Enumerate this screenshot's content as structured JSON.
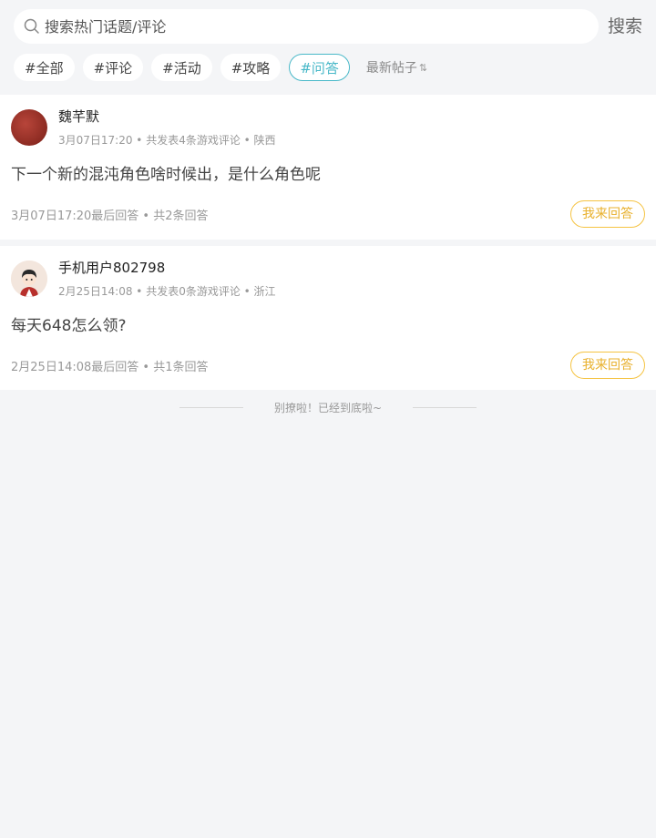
{
  "search": {
    "placeholder": "搜索热门话题/评论",
    "value": "",
    "button_label": "搜索"
  },
  "filters": {
    "tags": [
      {
        "label": "#全部",
        "active": false
      },
      {
        "label": "#评论",
        "active": false
      },
      {
        "label": "#活动",
        "active": false
      },
      {
        "label": "#攻略",
        "active": false
      },
      {
        "label": "#问答",
        "active": true
      }
    ],
    "sort_label": "最新帖子",
    "sort_icon": "⇅"
  },
  "posts": [
    {
      "username": "魏芊默",
      "meta": "3月07日17:20 • 共发表4条游戏评论 • 陕西",
      "title": "下一个新的混沌角色啥时候出，是什么角色呢",
      "footer": "3月07日17:20最后回答 • 共2条回答",
      "answer_label": "我来回答"
    },
    {
      "username": "手机用户802798",
      "meta": "2月25日14:08 • 共发表0条游戏评论 • 浙江",
      "title": "每天648怎么领?",
      "footer": "2月25日14:08最后回答 • 共1条回答",
      "answer_label": "我来回答"
    }
  ],
  "end_text": "别撩啦！已经到底啦~",
  "colors": {
    "accent_teal": "#48b8c8",
    "answer_yellow": "#e8b02c",
    "background": "#f4f5f7"
  }
}
